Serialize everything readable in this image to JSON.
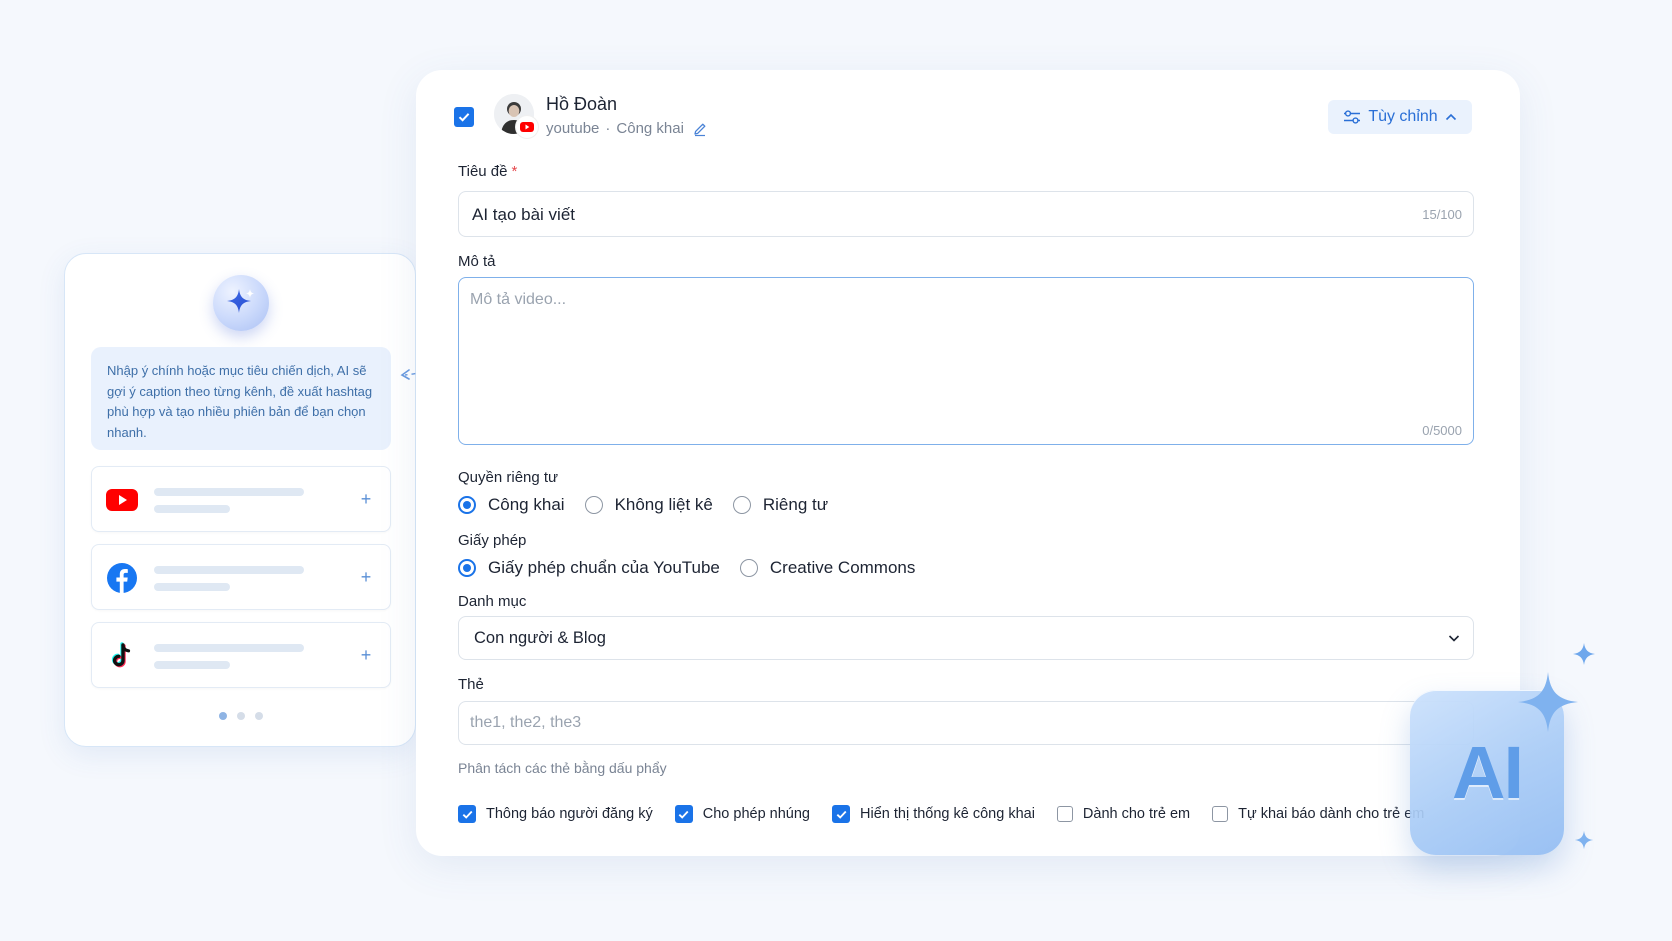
{
  "ai_panel": {
    "hint": "Nhập ý chính hoặc mục tiêu chiến dịch, AI sẽ gợi ý caption theo từng kênh, đề xuất hashtag phù hợp và tạo nhiều phiên bản để bạn chọn nhanh.",
    "channels": [
      {
        "icon": "youtube-logo-icon"
      },
      {
        "icon": "facebook-logo-icon"
      },
      {
        "icon": "tiktok-logo-icon"
      }
    ],
    "add_label": "+"
  },
  "account": {
    "name": "Hồ Đoàn",
    "platform": "youtube",
    "separator": "·",
    "visibility": "Công khai",
    "selected": true
  },
  "customize": {
    "label": "Tùy chỉnh"
  },
  "title_field": {
    "label": "Tiêu đề",
    "required_mark": "*",
    "value": "AI tạo bài viết",
    "counter": "15/100"
  },
  "description_field": {
    "label": "Mô tả",
    "placeholder": "Mô tả video...",
    "counter": "0/5000"
  },
  "privacy": {
    "label": "Quyền riêng tư",
    "options": [
      "Công khai",
      "Không liệt kê",
      "Riêng tư"
    ],
    "selected": "Công khai"
  },
  "license": {
    "label": "Giấy phép",
    "options": [
      "Giấy phép chuẩn của YouTube",
      "Creative Commons"
    ],
    "selected": "Giấy phép chuẩn của YouTube"
  },
  "category": {
    "label": "Danh mục",
    "value": "Con người & Blog"
  },
  "tags": {
    "label": "Thẻ",
    "placeholder": "the1, the2, the3",
    "helper": "Phân tách các thẻ bằng dấu phẩy"
  },
  "options": [
    {
      "label": "Thông báo người đăng ký",
      "checked": true
    },
    {
      "label": "Cho phép nhúng",
      "checked": true
    },
    {
      "label": "Hiển thị thống kê công khai",
      "checked": true
    },
    {
      "label": "Dành cho trẻ em",
      "checked": false
    },
    {
      "label": "Tự khai báo dành cho trẻ em",
      "checked": false
    }
  ],
  "ai_badge_text": "AI",
  "colors": {
    "accent": "#1a73e8",
    "youtube": "#ff0000",
    "facebook": "#1877f2",
    "hint_bg": "#e9f1fd"
  }
}
